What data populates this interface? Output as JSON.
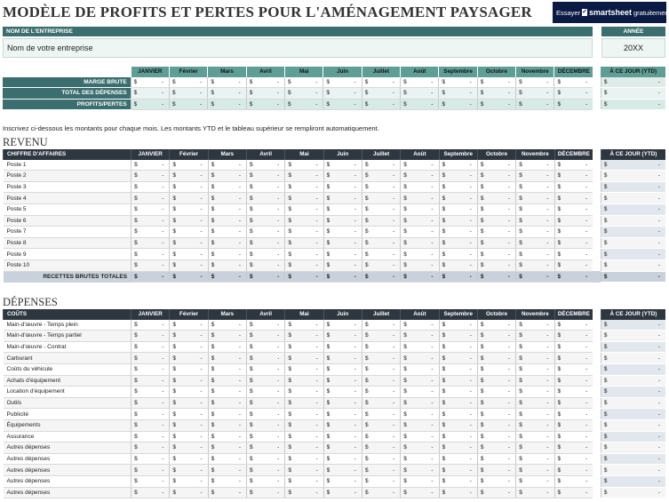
{
  "title": "MODÈLE DE PROFITS ET PERTES POUR L'AMÉNAGEMENT PAYSAGER",
  "ad": {
    "try": "Essayer",
    "brand": "smartsheet",
    "free": "gratuitement."
  },
  "company": {
    "label": "NOM DE L'ENTREPRISE",
    "value": "Nom de votre entreprise"
  },
  "year": {
    "label": "ANNÉE",
    "value": "20XX"
  },
  "months": [
    "JANVIER",
    "Février",
    "Mars",
    "Avril",
    "Mai",
    "Juin",
    "Juillet",
    "Août",
    "Septembre",
    "Octobre",
    "Novembre",
    "DÉCEMBRE"
  ],
  "ytd_label": "À CE JOUR (YTD)",
  "currency": "$",
  "empty_value": "-",
  "summary_rows": [
    "MARGE BRUTE",
    "TOTAL DES DÉPENSES",
    "PROFITS/PERTES"
  ],
  "instruction": "Inscrivez ci-dessous les montants pour chaque mois. Les montants YTD et le tableau supérieur se rempliront automatiquement.",
  "revenue": {
    "section_title": "REVENU",
    "header": "CHIFFRE D'AFFAIRES",
    "rows": [
      "Poste 1",
      "Poste 2",
      "Poste 3",
      "Poste 4",
      "Poste 5",
      "Poste 6",
      "Poste 7",
      "Poste 8",
      "Poste 9",
      "Poste 10"
    ],
    "total_label": "RECETTES BRUTES TOTALES"
  },
  "expenses": {
    "section_title": "DÉPENSES",
    "header": "COÛTS",
    "rows": [
      "Main-d'œuvre - Temps plein",
      "Main-d'œuvre - Temps partiel",
      "Main-d'œuvre - Contrat",
      "Carburant",
      "Coûts du véhicule",
      "Achats d'équipement",
      "Location d'équipement",
      "Outils",
      "Publicité",
      "Équipements",
      "Assurance",
      "Autres dépenses",
      "Autres dépenses",
      "Autres dépenses",
      "Autres dépenses",
      "Autres dépenses"
    ]
  }
}
